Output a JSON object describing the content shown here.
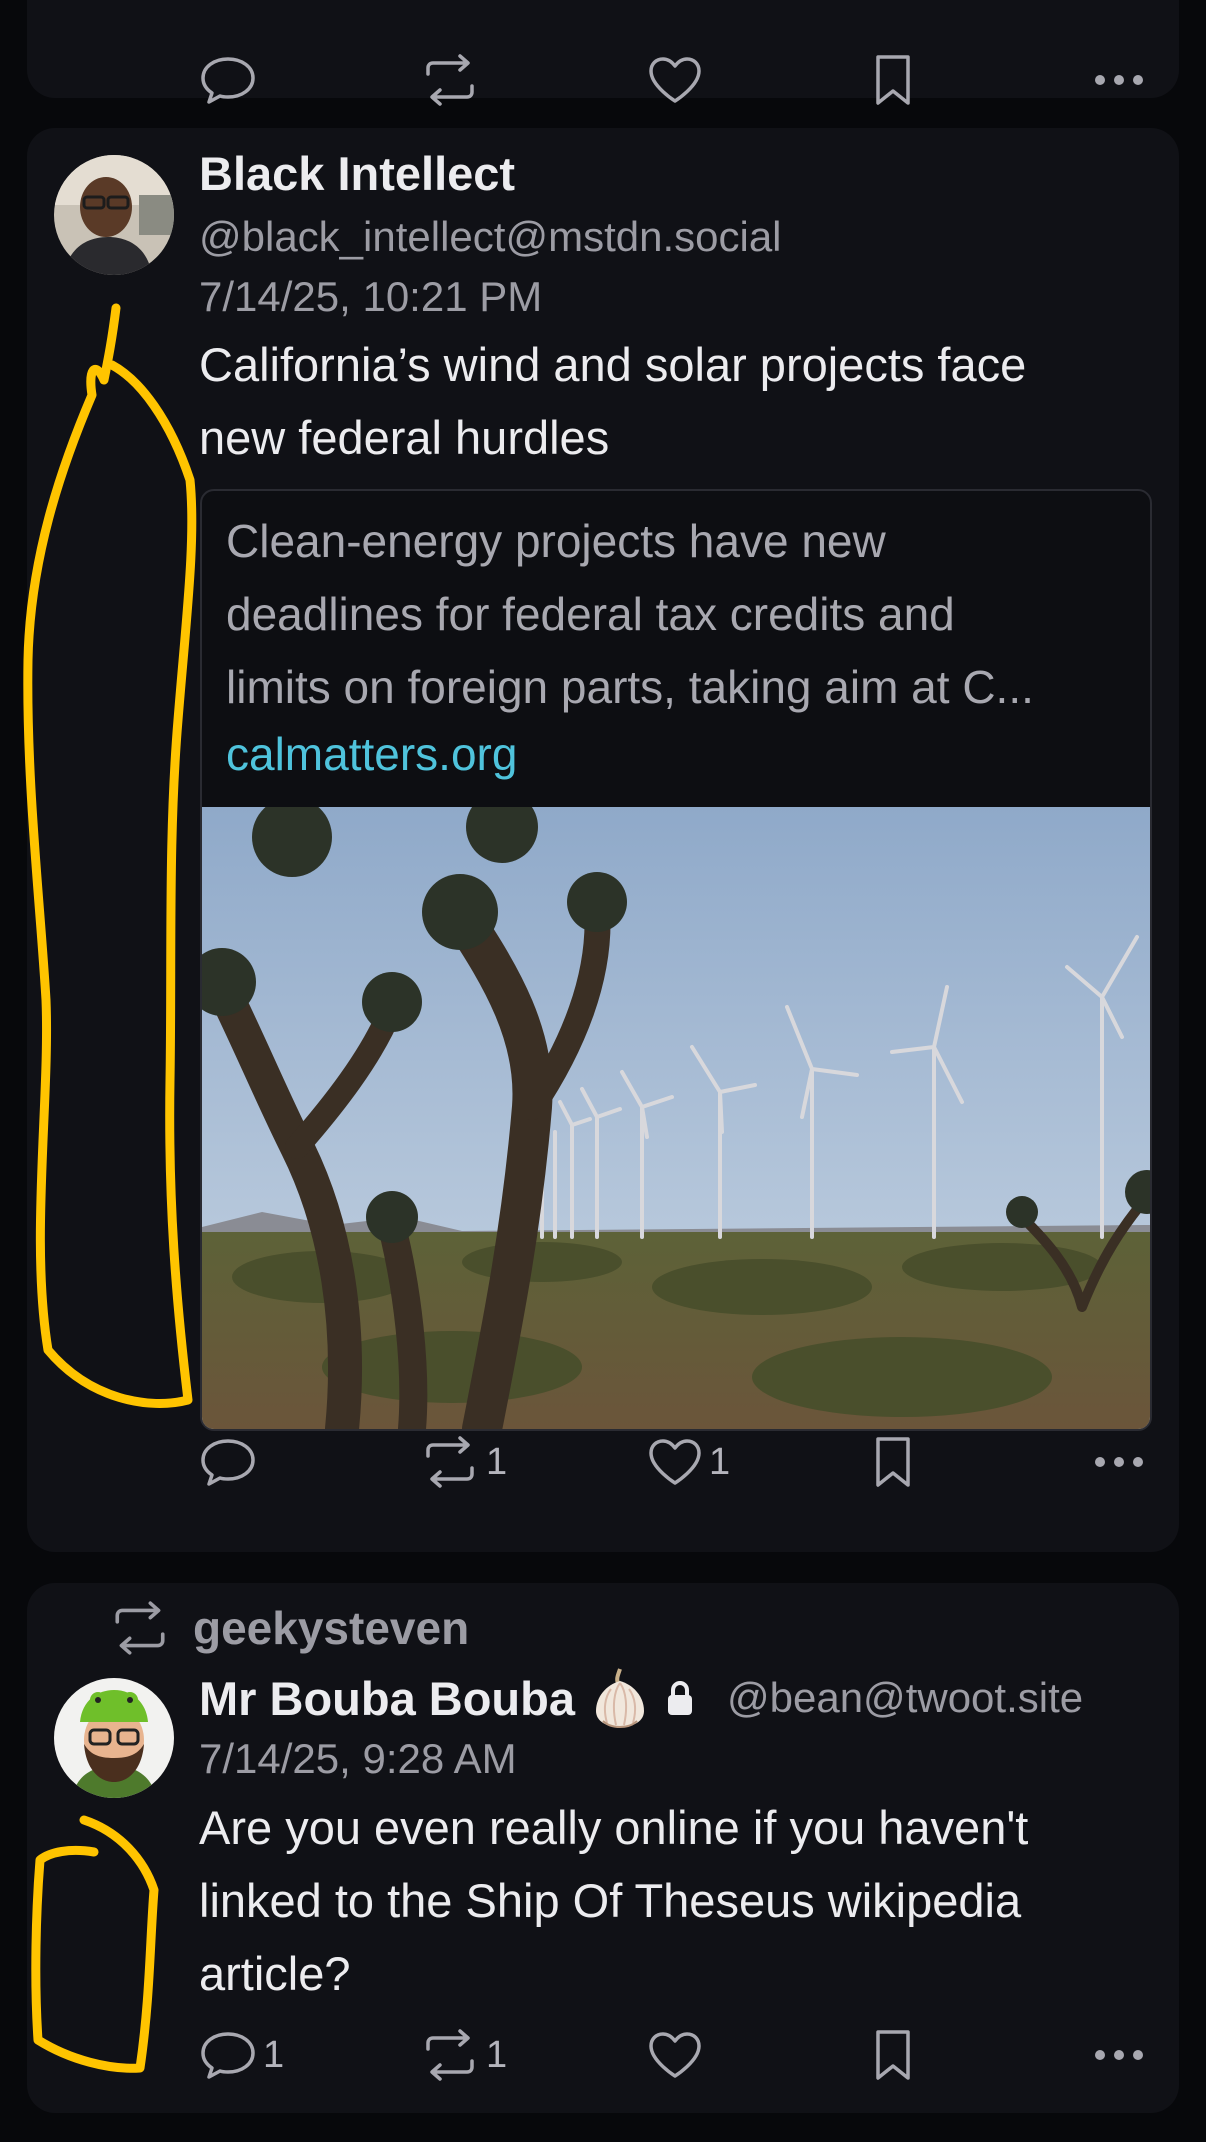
{
  "colors": {
    "background": "#07080b",
    "card": "#101116",
    "text_primary": "#ececef",
    "text_secondary": "#9c9ca4",
    "link": "#4fc3dc",
    "annotation": "#ffc400"
  },
  "actions_icons": [
    "reply-icon",
    "boost-icon",
    "heart-icon",
    "bookmark-icon",
    "more-icon"
  ],
  "post1": {
    "display_name": "Black Intellect",
    "handle": "@black_intellect@mstdn.social",
    "date": "7/14/25, 10:21 PM",
    "text_line1": "California’s wind and solar projects face",
    "text_line2": "new federal hurdles",
    "link_card": {
      "desc_line1": "Clean-energy projects have new",
      "desc_line2": "deadlines for federal tax credits and",
      "desc_line3": "limits on foreign parts, taking aim at C...",
      "domain": "calmatters.org"
    },
    "boosts": "1",
    "likes": "1"
  },
  "post2": {
    "boosted_by": "geekysteven",
    "display_name": "Mr Bouba Bouba",
    "handle": "@bean@twoot.site",
    "date": "7/14/25, 9:28 AM",
    "text_line1": "Are you even really online if you haven't",
    "text_line2": "linked to the Ship Of Theseus wikipedia",
    "text_line3": "article?",
    "replies": "1",
    "boosts": "1"
  }
}
